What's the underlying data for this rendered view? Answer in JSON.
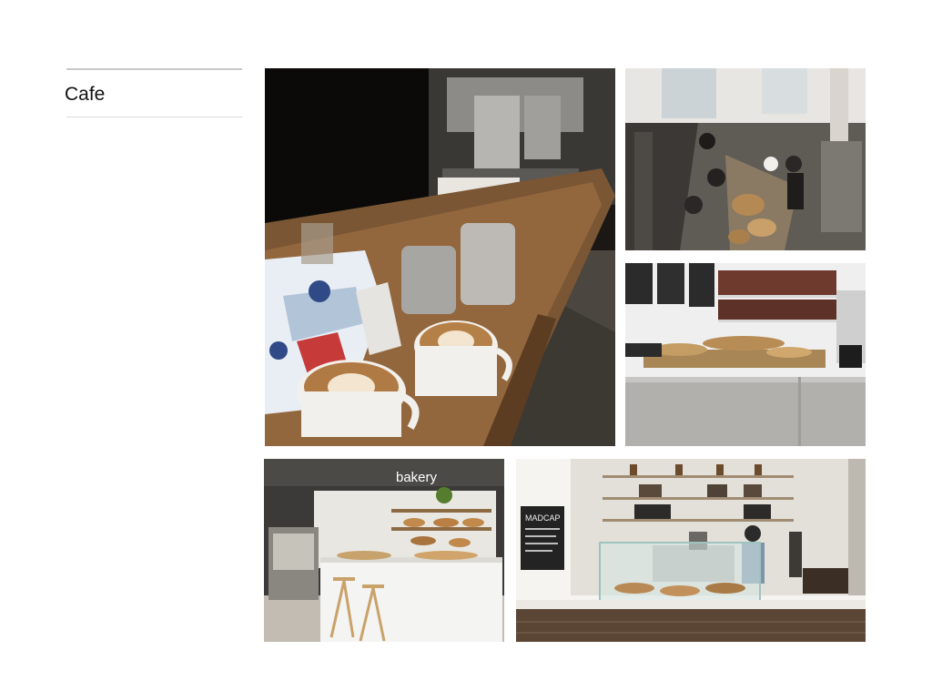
{
  "sidebar": {
    "title": "Cafe"
  },
  "gallery": {
    "tile_4_sign": "bakery",
    "tile_5_sign": "MADCAP"
  },
  "colors": {
    "divider_strong": "#c8c8c8",
    "divider_light": "#dcdcdc",
    "title_text": "#111111",
    "background": "#ffffff"
  }
}
